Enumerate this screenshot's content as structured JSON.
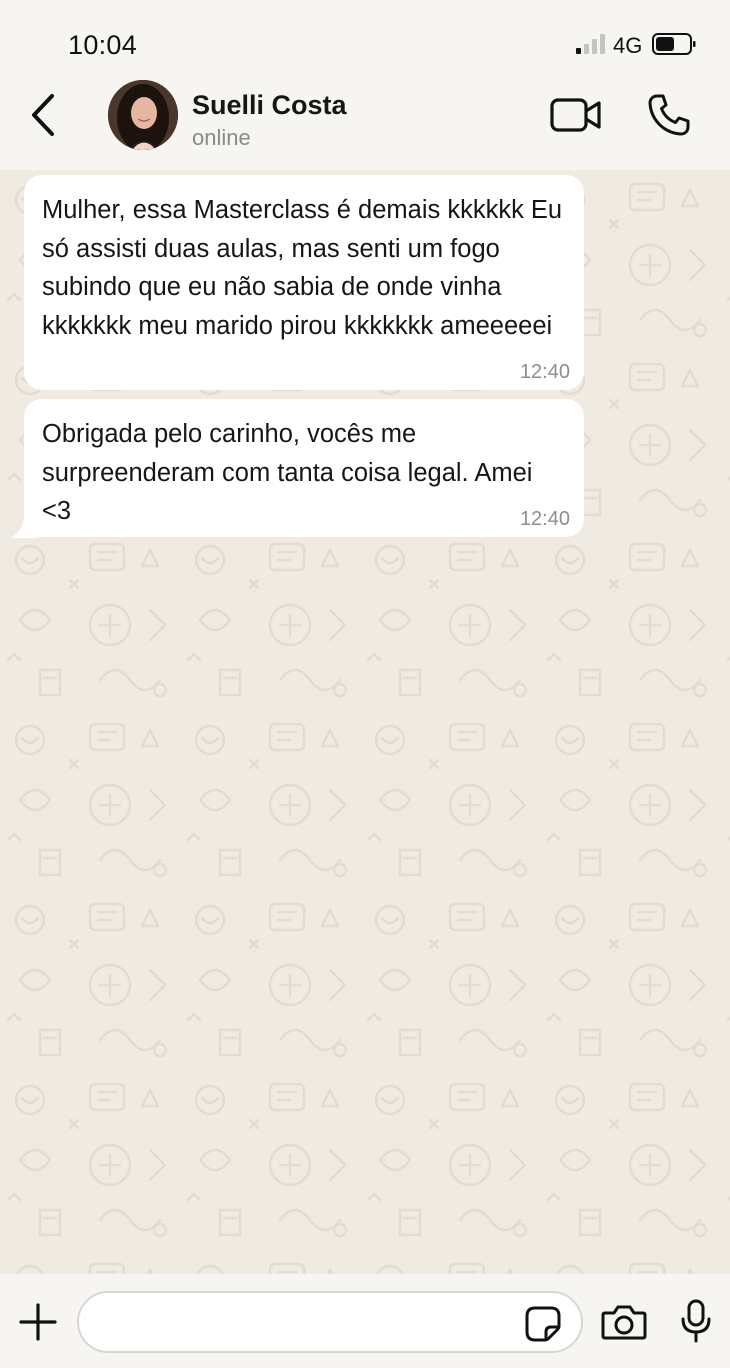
{
  "status_bar": {
    "time": "10:04",
    "network": "4G",
    "signal_bars_active": 1,
    "signal_bars_total": 4,
    "battery_icon": "battery-icon"
  },
  "header": {
    "back_icon": "chevron-left-icon",
    "contact_name": "Suelli Costa",
    "contact_status": "online",
    "video_icon": "video-camera-icon",
    "call_icon": "phone-icon"
  },
  "messages": [
    {
      "text": "Mulher, essa Masterclass é demais kkkkkk Eu só assisti duas aulas, mas senti um fogo subindo que eu não sabia de onde vinha kkkkkkk meu marido pirou kkkkkkk ameeeeei",
      "time": "12:40"
    },
    {
      "text": "Obrigada pelo carinho, vocês me surpreenderam com tanta coisa legal. Amei <3",
      "time": "12:40"
    }
  ],
  "input_bar": {
    "plus_icon": "plus-icon",
    "input_value": "",
    "input_placeholder": "",
    "sticker_icon": "sticker-icon",
    "camera_icon": "camera-icon",
    "mic_icon": "microphone-icon"
  },
  "colors": {
    "header_bg": "#f6f5f2",
    "chat_bg": "#efeae2",
    "bubble_bg": "#ffffff",
    "timestamp": "#8e8e8e",
    "status_text": "#8a8a8a"
  }
}
